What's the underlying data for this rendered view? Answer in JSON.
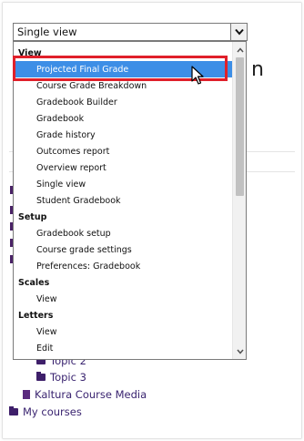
{
  "select": {
    "value": "Single view",
    "arrow_icon": "chevron-down-icon"
  },
  "background": {
    "title_fragment": "n",
    "tree_items": [
      {
        "label": "Topic 2",
        "icon": "folder-icon"
      },
      {
        "label": "Topic 3",
        "icon": "folder-icon"
      },
      {
        "label": "Kaltura Course Media",
        "icon": "document-icon"
      },
      {
        "label": "My courses",
        "icon": "folder-icon"
      }
    ]
  },
  "dropdown": {
    "groups": [
      {
        "label": "View",
        "options": [
          "Projected Final Grade",
          "Course Grade Breakdown",
          "Gradebook Builder",
          "Gradebook",
          "Grade history",
          "Outcomes report",
          "Overview report",
          "Single view",
          "Student Gradebook"
        ]
      },
      {
        "label": "Setup",
        "options": [
          "Gradebook setup",
          "Course grade settings",
          "Preferences: Gradebook"
        ]
      },
      {
        "label": "Scales",
        "options": [
          "View"
        ]
      },
      {
        "label": "Letters",
        "options": [
          "View",
          "Edit"
        ]
      }
    ],
    "highlighted_option": "Projected Final Grade"
  },
  "colors": {
    "selection": "#3d8ee6",
    "annotation_box": "#e0202a",
    "tree_text": "#3a2470"
  }
}
